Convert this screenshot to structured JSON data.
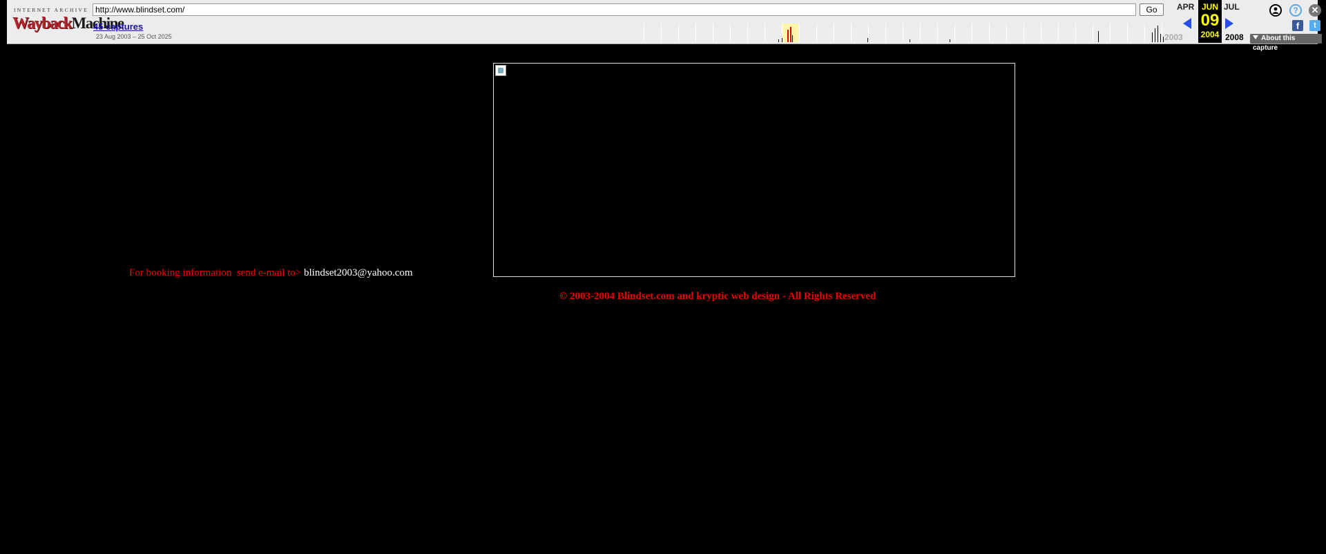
{
  "toolbar": {
    "logo_top": "INTERNET ARCHIVE",
    "logo_way": "Wayback",
    "logo_machine": "Machine",
    "url": "http://www.blindset.com/",
    "go_label": "Go",
    "captures_label": "45 captures",
    "date_range": "23 Aug 2003 – 25 Oct 2025",
    "calendar": {
      "prev_month": "APR",
      "current_month": "JUN",
      "current_day": "09",
      "next_month": "JUL",
      "prev_year": "2003",
      "current_year": "2004",
      "next_year": "2008"
    },
    "about_label": "About this capture",
    "help_glyph": "?",
    "close_glyph": "✕",
    "facebook_glyph": "f",
    "twitter_glyph": "t",
    "icons": [
      "user-icon",
      "help-icon",
      "close-icon",
      "facebook-icon",
      "twitter-icon"
    ]
  },
  "content": {
    "booking_label": "For booking information  send e-mail to> ",
    "booking_email": "blindset2003@yahoo.com",
    "copyright": "© 2003-2004 Blindset.com and kryptic web design - All Rights Reserved"
  },
  "colors": {
    "page_bg": "#000000",
    "accent_red": "#ee0000",
    "toolbar_bg": "#ececec",
    "link": "#1a0dab"
  }
}
